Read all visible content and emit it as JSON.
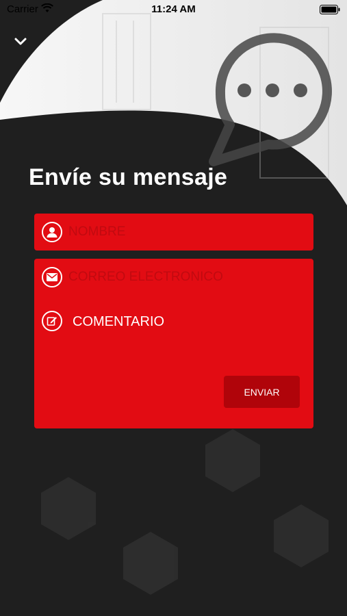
{
  "status_bar": {
    "carrier": "Carrier",
    "time": "11:24 AM"
  },
  "header": {
    "back_icon": "chevron-down-icon",
    "decoration_icon": "chat-bubble-icon"
  },
  "page": {
    "title": "Envíe su mensaje"
  },
  "form": {
    "name": {
      "placeholder": "NOMBRE",
      "icon": "user-icon"
    },
    "email": {
      "placeholder": "CORREO ELECTRONICO",
      "icon": "envelope-icon"
    },
    "comment": {
      "placeholder": "COMENTARIO",
      "icon": "edit-icon"
    },
    "submit_label": "ENVIAR"
  },
  "colors": {
    "accent": "#e20c13",
    "button": "#b0040a",
    "background": "#1f1f1f"
  }
}
